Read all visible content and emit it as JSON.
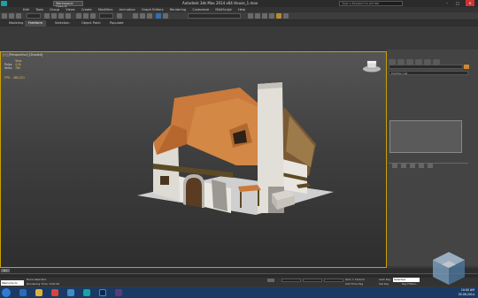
{
  "titlebar": {
    "workspace": "Workspace: Default",
    "title": "Autodesk 3ds Max  2014 x64     House_1.max",
    "search_placeholder": "Type a keyword or phrase",
    "minimize": "–",
    "maximize": "□",
    "close": "✕"
  },
  "menu": [
    "Edit",
    "Tools",
    "Group",
    "Views",
    "Create",
    "Modifiers",
    "Animation",
    "Graph Editors",
    "Rendering",
    "Customize",
    "MAXScript",
    "Help"
  ],
  "ribbon_tabs": [
    "Modeling",
    "Freeform",
    "Selection",
    "Object Paint",
    "Populate"
  ],
  "viewport": {
    "label": "[+] [Perspective] [Shaded]",
    "stats": [
      {
        "k": "",
        "v": "Total"
      },
      {
        "k": "Polys:",
        "v": "4,3k"
      },
      {
        "k": "Verts:",
        "v": "760"
      }
    ],
    "fps_label": "FPS:",
    "fps_value": "480,321"
  },
  "command_panel": {
    "modifier_list": "Modifier List"
  },
  "timeline": {
    "slider": "0 / 100"
  },
  "status": {
    "maxscript": "Welcome to MAX",
    "line1": "None Selected",
    "line2": "Rendering Time: 0:00:00",
    "grid": "Grid = 10,0cm",
    "add_time_tag": "Add Time Tag",
    "auto_key": "Auto Key",
    "set_key": "Set Key",
    "selected": "Selected",
    "key_filters": "Key Filters..."
  },
  "taskbar": {
    "time": "10:00 AM",
    "date": "05.06.2014"
  },
  "colors": {
    "roof": "#c97a3c",
    "wall": "#e8e4df",
    "stone": "#9b9892",
    "beam": "#5c4a24",
    "door": "#5a3c22",
    "ground": "#cfcfcf",
    "accent": "#c9a000"
  }
}
